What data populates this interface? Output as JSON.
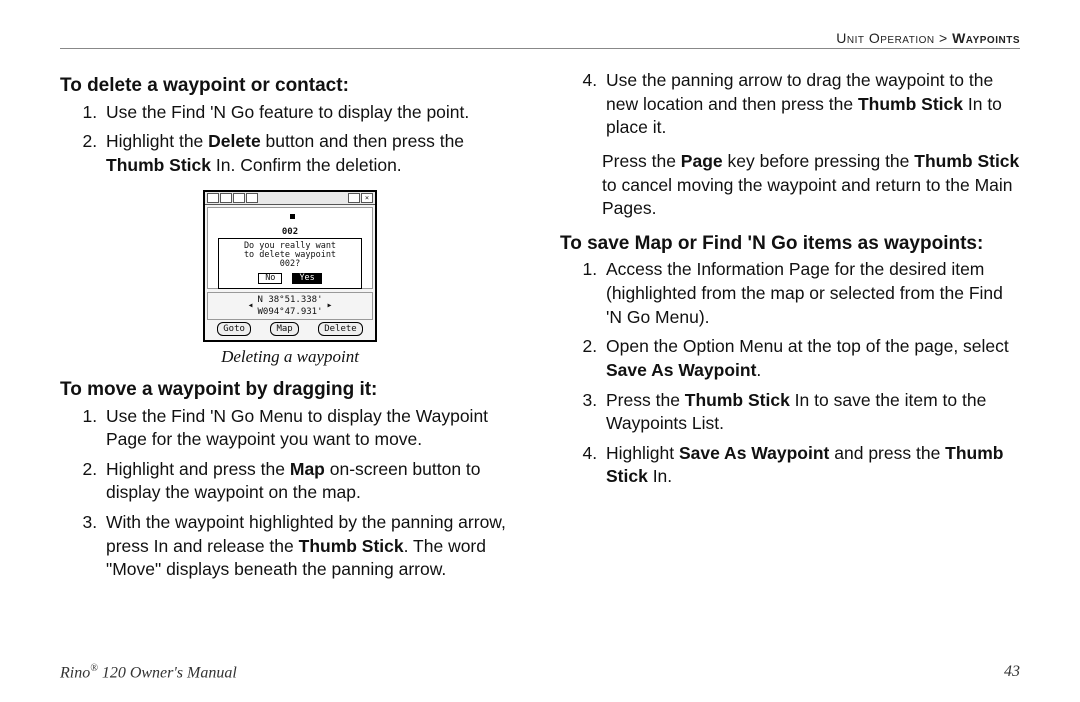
{
  "runningHead": {
    "left": "Unit Operation",
    "sep": " > ",
    "right": "Waypoints"
  },
  "leftColumn": {
    "sectionA": {
      "title": "To delete a waypoint or contact:",
      "items": [
        "Use the Find 'N Go feature to display the point.",
        {
          "pre": "Highlight the ",
          "b1": "Delete",
          "mid": " button and then press the ",
          "b2": "Thumb Stick",
          "post": " In. Confirm the deletion."
        }
      ]
    },
    "figure": {
      "caption": "Deleting a waypoint",
      "wpLabel": "002",
      "dialogLine1": "Do you really want",
      "dialogLine2": "to delete waypoint",
      "dialogLine3": "002?",
      "btnNo": "No",
      "btnYes": "Yes",
      "coordN": "N 38°51.338'",
      "coordW": "W094°47.931'",
      "soft1": "Goto",
      "soft2": "Map",
      "soft3": "Delete"
    },
    "sectionB": {
      "title": "To move a waypoint by dragging it:",
      "items": [
        "Use the Find 'N Go Menu to display the Waypoint Page for the waypoint you want to move.",
        {
          "pre": "Highlight and press the ",
          "b1": "Map",
          "post": " on-screen button to display the waypoint on the map."
        },
        {
          "pre": "With the waypoint highlighted by the panning arrow, press In and release the ",
          "b1": "Thumb Stick",
          "post": ". The word \"Move\" displays beneath the panning arrow."
        }
      ]
    }
  },
  "rightColumn": {
    "continuation": {
      "item4": {
        "pre": "Use the panning arrow to drag the waypoint to the new location and then press the ",
        "b1": "Thumb Stick",
        "post": " In to place it."
      },
      "note": {
        "pre": "Press the ",
        "b1": "Page",
        "mid": " key before pressing the ",
        "b2": "Thumb Stick",
        "post": " to cancel moving the waypoint and return to the Main Pages."
      }
    },
    "sectionC": {
      "title": "To save Map or Find 'N Go items as waypoints:",
      "items": [
        "Access the Information Page for the desired item (highlighted from the map or selected from the Find 'N Go Menu).",
        {
          "pre": "Open the Option Menu at the top of the page, select ",
          "b1": "Save As Waypoint",
          "post": "."
        },
        {
          "pre": "Press the ",
          "b1": "Thumb Stick",
          "post": " In to save the item to the Waypoints List."
        },
        {
          "pre": "Highlight ",
          "b1": "Save As Waypoint",
          "mid": " and press the ",
          "b2": "Thumb Stick",
          "post": " In."
        }
      ]
    }
  },
  "footer": {
    "manual_pre": "Rino",
    "manual_sup": "®",
    "manual_post": " 120 Owner's Manual",
    "pageNumber": "43"
  }
}
